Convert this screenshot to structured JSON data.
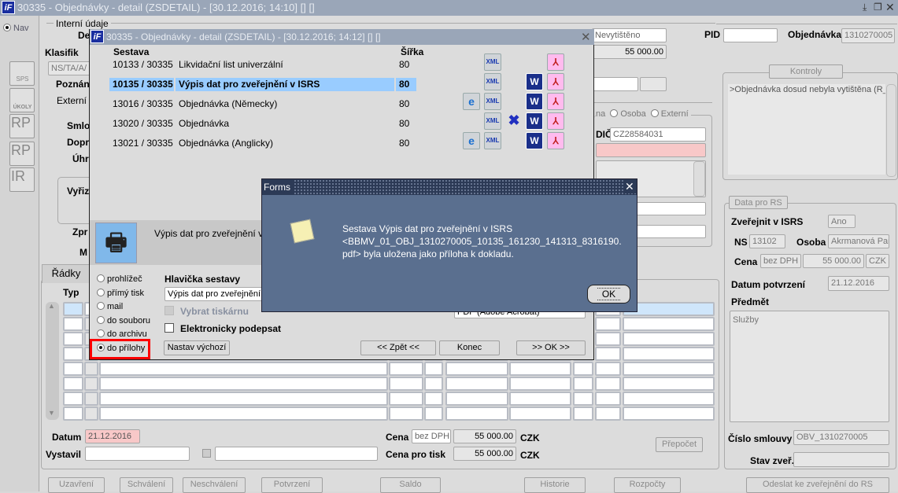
{
  "window": {
    "title": "30335 - Objednávky - detail (ZSDETAIL) - [30.12.2016; 14:10] [] []",
    "logo": "iF"
  },
  "toolbar": {
    "nav": "Nav",
    "tools": [
      "SPS",
      "ÚKOLY",
      "RP",
      "RP",
      "IR"
    ]
  },
  "form": {
    "interni_udaje": "Interní údaje",
    "de": "De",
    "klasifik": "Klasifik",
    "klasifik_value": "NS/TA/A/",
    "poznam": "Poznán",
    "externi": "Externí t",
    "smlo": "Smlo",
    "dopr": "Dopr",
    "uhr": "Úhr",
    "vyriz": "Vyřiz",
    "zpr": "Zpr",
    "m": "M",
    "tab_radky": "Řádky",
    "typ": "Typ",
    "stav": "Nevytištěno",
    "castka": "55 000.00",
    "pid_label": "PID",
    "pid": "",
    "objednavka_label": "Objednávka",
    "objednavka": "1310270005",
    "kontroly": "Kontroly",
    "kontroly_text": ">Objednávka dosud nebyla vytištěna (R_",
    "radio_na": "na",
    "radio_osoba": "Osoba",
    "radio_externi": "Externí",
    "dic_label": "DIČ",
    "dic": "CZ28584031",
    "datum_label": "Datum",
    "datum": "21.12.2016",
    "vystavil_label": "Vystavil",
    "cena_label": "Cena",
    "cena_typ": "bez DPH",
    "cena": "55 000.00",
    "mena": "CZK",
    "cena_tisk_label": "Cena pro tisk",
    "cena_tisk": "55 000.00",
    "prepocet": "Přepočet"
  },
  "rs": {
    "legend": "Data pro RS",
    "zverejnit_label": "Zveřejnit v ISRS",
    "zverejnit": "Ano",
    "ns_label": "NS",
    "ns": "13102",
    "osoba_label": "Osoba",
    "osoba": "Akrmanová Par",
    "cena_label": "Cena",
    "cena_typ": "bez DPH",
    "cena": "55 000.00",
    "mena": "CZK",
    "datum_label": "Datum potvrzení",
    "datum": "21.12.2016",
    "predmet_label": "Předmět",
    "predmet": "Služby",
    "cislo_label": "Číslo smlouvy",
    "cislo": "OBV_1310270005",
    "stav_label": "Stav zveř.",
    "stav": ""
  },
  "bottom_buttons": [
    "Uzavření",
    "Schválení",
    "Neschválení",
    "Potvrzení",
    "Saldo",
    "Historie",
    "Rozpočty",
    "Odeslat ke zveřejnění do RS"
  ],
  "report_dialog": {
    "title": "30335 - Objednávky - detail (ZSDETAIL) - [30.12.2016; 14:12] [] []",
    "col_sestava": "Sestava",
    "col_sirka": "Šířka",
    "rows": [
      {
        "id": "10133 / 30335",
        "name": "Likvidační list univerzální",
        "width": "80",
        "icons": [
          "xml",
          "pdf"
        ]
      },
      {
        "id": "10135 / 30335",
        "name": "Výpis dat pro zveřejnění v ISRS",
        "width": "80",
        "icons": [
          "xml",
          "word",
          "pdf"
        ],
        "selected": true
      },
      {
        "id": "13016 / 30335",
        "name": "Objednávka (Německy)",
        "width": "80",
        "icons": [
          "ie",
          "xml",
          "word",
          "pdf"
        ]
      },
      {
        "id": "13020 / 30335",
        "name": "Objednávka",
        "width": "80",
        "icons": [
          "xml",
          "excel",
          "word",
          "pdf"
        ]
      },
      {
        "id": "13021 / 30335",
        "name": "Objednávka (Anglicky)",
        "width": "80",
        "icons": [
          "ie",
          "xml",
          "word",
          "pdf"
        ]
      }
    ],
    "selected_name": "Výpis dat pro zveřejnění v ISRS",
    "outputs": [
      "prohlížeč",
      "přímý tisk",
      "mail",
      "do souboru",
      "do archivu",
      "do přílohy"
    ],
    "selected_output": "do přílohy",
    "hlavicka_label": "Hlavička sestavy",
    "hlavicka": "Výpis dat pro zveřejnění v ISRS",
    "format": "PDF (Adobe Acrobat)",
    "vybrat_tiskarnu": "Vybrat tiskárnu",
    "podepsat": "Elektronicky podepsat",
    "nastav": "Nastav výchozí",
    "zpet": "<< Zpět <<",
    "konec": "Konec",
    "ok": ">> OK >>"
  },
  "alert": {
    "title": "Forms",
    "lines": [
      "Sestava Výpis dat pro zveřejnění v ISRS",
      "<BBMV_01_OBJ_1310270005_10135_161230_141313_8316190.",
      "pdf> byla uložena jako příloha k dokladu."
    ],
    "ok": "OK"
  },
  "colors": {
    "titlebar": "#9aa6b8",
    "selection": "#99ccff",
    "alert_bg": "#5a6f8f",
    "highlight_box": "#ff0000",
    "required": "#f8c8c8"
  }
}
